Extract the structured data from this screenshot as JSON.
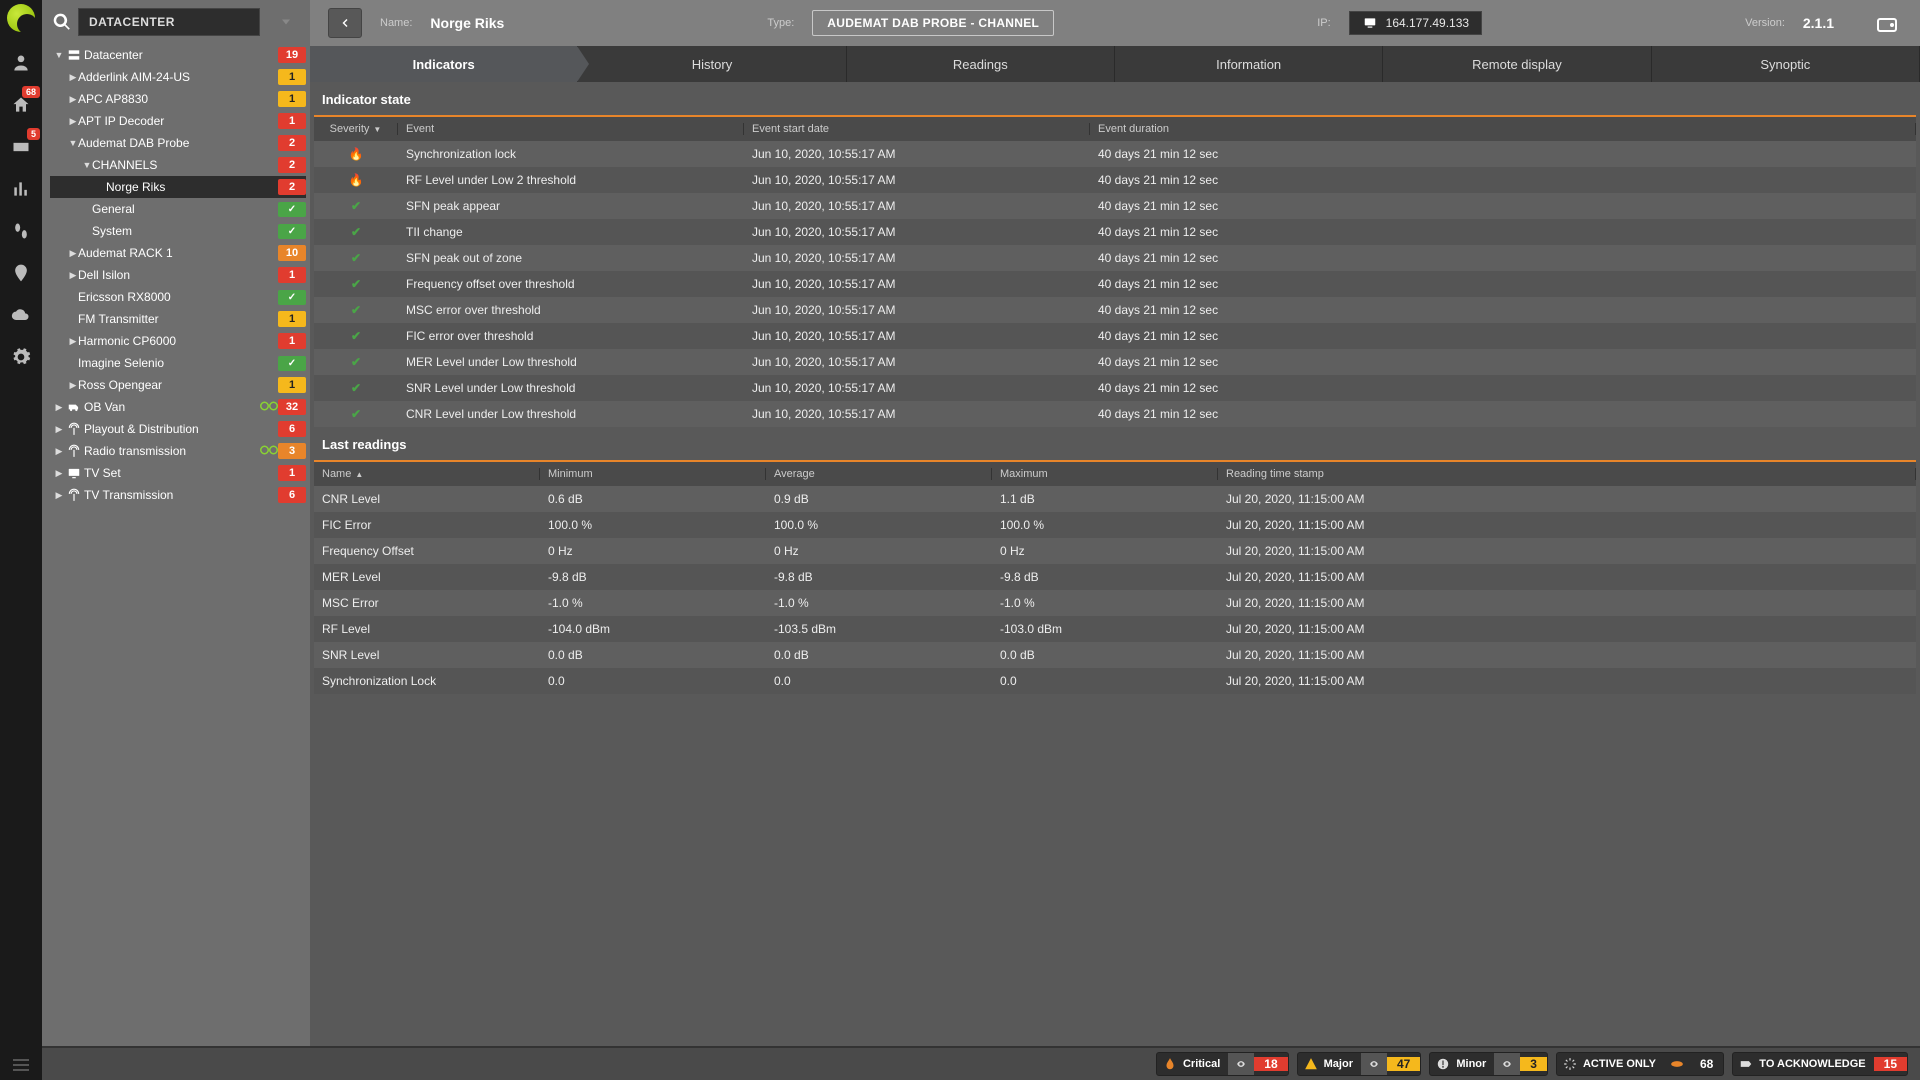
{
  "sidebar": {
    "search_value": "DATACENTER",
    "tree": [
      {
        "caret": "▼",
        "icon": "server",
        "label": "Datacenter",
        "badge": "19",
        "bclass": "b-red",
        "ind": 0
      },
      {
        "caret": "▶",
        "label": "Adderlink AIM-24-US",
        "badge": "1",
        "bclass": "b-yellow",
        "ind": 1
      },
      {
        "caret": "▶",
        "label": "APC AP8830",
        "badge": "1",
        "bclass": "b-yellow",
        "ind": 1
      },
      {
        "caret": "▶",
        "label": "APT IP Decoder",
        "badge": "1",
        "bclass": "b-red",
        "ind": 1
      },
      {
        "caret": "▼",
        "label": "Audemat DAB Probe",
        "badge": "2",
        "bclass": "b-red",
        "ind": 1
      },
      {
        "caret": "▼",
        "label": "CHANNELS",
        "badge": "2",
        "bclass": "b-red",
        "ind": 2
      },
      {
        "caret": "",
        "label": "Norge Riks",
        "badge": "2",
        "bclass": "b-red",
        "ind": 3,
        "sel": true
      },
      {
        "caret": "",
        "label": "General",
        "badge": "",
        "bclass": "b-green",
        "ind": 2
      },
      {
        "caret": "",
        "label": "System",
        "badge": "",
        "bclass": "b-green",
        "ind": 2
      },
      {
        "caret": "▶",
        "label": "Audemat RACK 1",
        "badge": "10",
        "bclass": "b-orange",
        "ind": 1
      },
      {
        "caret": "▶",
        "label": "Dell Isilon",
        "badge": "1",
        "bclass": "b-red",
        "ind": 1
      },
      {
        "caret": "",
        "label": "Ericsson RX8000",
        "badge": "",
        "bclass": "b-green",
        "ind": 1
      },
      {
        "caret": "",
        "label": "FM Transmitter",
        "badge": "1",
        "bclass": "b-yellow",
        "ind": 1
      },
      {
        "caret": "▶",
        "label": "Harmonic CP6000",
        "badge": "1",
        "bclass": "b-red",
        "ind": 1
      },
      {
        "caret": "",
        "label": "Imagine Selenio",
        "badge": "",
        "bclass": "b-green",
        "ind": 1
      },
      {
        "caret": "▶",
        "label": "Ross Opengear",
        "badge": "1",
        "bclass": "b-yellow",
        "ind": 1
      },
      {
        "caret": "▶",
        "icon": "van",
        "label": "OB Van",
        "badge": "32",
        "bclass": "b-red",
        "ind": 0,
        "indic": true
      },
      {
        "caret": "▶",
        "icon": "antenna",
        "label": "Playout & Distribution",
        "badge": "6",
        "bclass": "b-red",
        "ind": 0
      },
      {
        "caret": "▶",
        "icon": "antenna",
        "label": "Radio transmission",
        "badge": "3",
        "bclass": "b-orange",
        "ind": 0,
        "indic": true
      },
      {
        "caret": "▶",
        "icon": "tv",
        "label": "TV Set",
        "badge": "1",
        "bclass": "b-red",
        "ind": 0
      },
      {
        "caret": "▶",
        "icon": "antenna",
        "label": "TV Transmission",
        "badge": "6",
        "bclass": "b-red",
        "ind": 0
      }
    ]
  },
  "nav_badges": {
    "home": "68",
    "ticket": "5"
  },
  "header": {
    "name_lbl": "Name:",
    "name_val": "Norge Riks",
    "type_lbl": "Type:",
    "type_val": "AUDEMAT DAB PROBE - CHANNEL",
    "ip_lbl": "IP:",
    "ip_val": "164.177.49.133",
    "ver_lbl": "Version:",
    "ver_val": "2.1.1"
  },
  "tabs": [
    "Indicators",
    "History",
    "Readings",
    "Information",
    "Remote display",
    "Synoptic"
  ],
  "sections": {
    "ind": "Indicator state",
    "read": "Last readings"
  },
  "ind_head": {
    "sev": "Severity",
    "evt": "Event",
    "date": "Event start date",
    "dur": "Event duration"
  },
  "ind_rows": [
    {
      "sev": "fire",
      "evt": "Synchronization lock",
      "date": "Jun 10, 2020, 10:55:17 AM",
      "dur": "40 days 21 min 12 sec"
    },
    {
      "sev": "fire",
      "evt": "RF Level under Low 2 threshold",
      "date": "Jun 10, 2020, 10:55:17 AM",
      "dur": "40 days 21 min 12 sec"
    },
    {
      "sev": "ok",
      "evt": "SFN peak appear",
      "date": "Jun 10, 2020, 10:55:17 AM",
      "dur": "40 days 21 min 12 sec"
    },
    {
      "sev": "ok",
      "evt": "TII change",
      "date": "Jun 10, 2020, 10:55:17 AM",
      "dur": "40 days 21 min 12 sec"
    },
    {
      "sev": "ok",
      "evt": "SFN peak out of zone",
      "date": "Jun 10, 2020, 10:55:17 AM",
      "dur": "40 days 21 min 12 sec"
    },
    {
      "sev": "ok",
      "evt": "Frequency offset over threshold",
      "date": "Jun 10, 2020, 10:55:17 AM",
      "dur": "40 days 21 min 12 sec"
    },
    {
      "sev": "ok",
      "evt": "MSC error over threshold",
      "date": "Jun 10, 2020, 10:55:17 AM",
      "dur": "40 days 21 min 12 sec"
    },
    {
      "sev": "ok",
      "evt": "FIC error over threshold",
      "date": "Jun 10, 2020, 10:55:17 AM",
      "dur": "40 days 21 min 12 sec"
    },
    {
      "sev": "ok",
      "evt": "MER Level under Low threshold",
      "date": "Jun 10, 2020, 10:55:17 AM",
      "dur": "40 days 21 min 12 sec"
    },
    {
      "sev": "ok",
      "evt": "SNR Level under Low threshold",
      "date": "Jun 10, 2020, 10:55:17 AM",
      "dur": "40 days 21 min 12 sec"
    },
    {
      "sev": "ok",
      "evt": "CNR Level under Low threshold",
      "date": "Jun 10, 2020, 10:55:17 AM",
      "dur": "40 days 21 min 12 sec"
    }
  ],
  "read_head": {
    "name": "Name",
    "min": "Minimum",
    "avg": "Average",
    "max": "Maximum",
    "ts": "Reading time stamp"
  },
  "read_rows": [
    {
      "name": "CNR Level",
      "min": "0.6 dB",
      "avg": "0.9 dB",
      "max": "1.1 dB",
      "ts": "Jul 20, 2020, 11:15:00 AM"
    },
    {
      "name": "FIC Error",
      "min": "100.0 %",
      "avg": "100.0 %",
      "max": "100.0 %",
      "ts": "Jul 20, 2020, 11:15:00 AM"
    },
    {
      "name": "Frequency Offset",
      "min": "0 Hz",
      "avg": "0 Hz",
      "max": "0 Hz",
      "ts": "Jul 20, 2020, 11:15:00 AM"
    },
    {
      "name": "MER Level",
      "min": "-9.8 dB",
      "avg": "-9.8 dB",
      "max": "-9.8 dB",
      "ts": "Jul 20, 2020, 11:15:00 AM"
    },
    {
      "name": "MSC Error",
      "min": "-1.0 %",
      "avg": "-1.0 %",
      "max": "-1.0 %",
      "ts": "Jul 20, 2020, 11:15:00 AM"
    },
    {
      "name": "RF Level",
      "min": "-104.0 dBm",
      "avg": "-103.5 dBm",
      "max": "-103.0 dBm",
      "ts": "Jul 20, 2020, 11:15:00 AM"
    },
    {
      "name": "SNR Level",
      "min": "0.0 dB",
      "avg": "0.0 dB",
      "max": "0.0 dB",
      "ts": "Jul 20, 2020, 11:15:00 AM"
    },
    {
      "name": "Synchronization Lock",
      "min": "0.0",
      "avg": "0.0",
      "max": "0.0",
      "ts": "Jul 20, 2020, 11:15:00 AM"
    }
  ],
  "footer": {
    "critical_lbl": "Critical",
    "critical_cnt": "18",
    "major_lbl": "Major",
    "major_cnt": "47",
    "minor_lbl": "Minor",
    "minor_cnt": "3",
    "active_lbl": "ACTIVE ONLY",
    "active_cnt": "68",
    "ack_lbl": "TO ACKNOWLEDGE",
    "ack_cnt": "15"
  }
}
